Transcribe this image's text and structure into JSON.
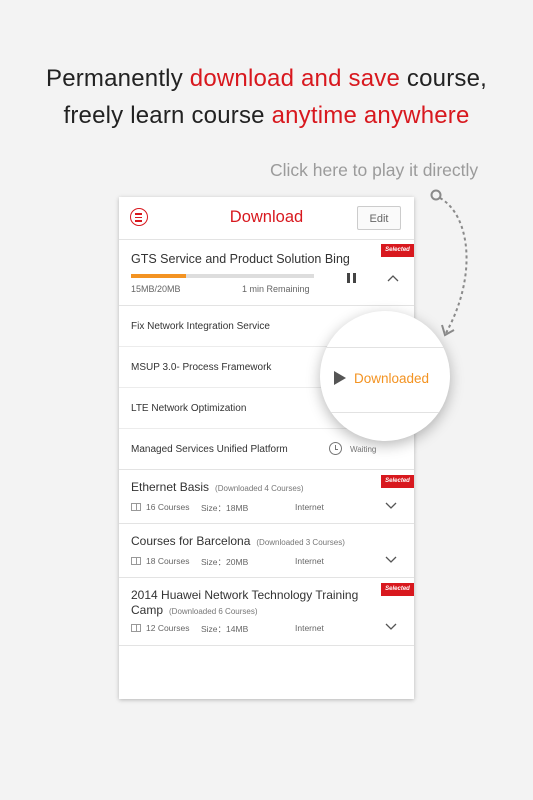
{
  "headline": {
    "line1": [
      {
        "text": "Permanently ",
        "accent": false
      },
      {
        "text": "download and save",
        "accent": true
      },
      {
        "text": " course,",
        "accent": false
      }
    ],
    "line2": [
      {
        "text": "freely learn course ",
        "accent": false
      },
      {
        "text": "anytime anywhere",
        "accent": true
      }
    ]
  },
  "hint": "Click here to play it directly",
  "app": {
    "title": "Download",
    "edit_label": "Edit",
    "ribbon_label": "Selected",
    "active_course": {
      "title": "GTS Service and Product Solution Bing",
      "progress": 0.3,
      "size": "15MB/20MB",
      "remaining": "1 min Remaining"
    },
    "sub_items": [
      {
        "label": "Fix Network Integration Service"
      },
      {
        "label": "MSUP 3.0- Process Framework"
      },
      {
        "label": "LTE Network Optimization"
      },
      {
        "label": "Managed Services Unified Platform",
        "status": "Waiting"
      }
    ],
    "downloaded_label": "Downloaded",
    "courses": [
      {
        "name": "Ethernet Basis",
        "downloaded": "(Downloaded 4 Courses)",
        "count": "16 Courses",
        "size": "Size：18MB",
        "source": "Internet",
        "selected": true
      },
      {
        "name": "Courses for Barcelona",
        "downloaded": "(Downloaded 3 Courses)",
        "count": "18 Courses",
        "size": "Size：20MB",
        "source": "Internet",
        "selected": false
      },
      {
        "name": "2014 Huawei Network Technology Training Camp",
        "downloaded": "(Downloaded 6 Courses)",
        "count": "12 Courses",
        "size": "Size：14MB",
        "source": "Internet",
        "selected": true
      }
    ]
  },
  "colors": {
    "accent": "#d8181e",
    "progress": "#f39322",
    "downloaded": "#f39322"
  }
}
